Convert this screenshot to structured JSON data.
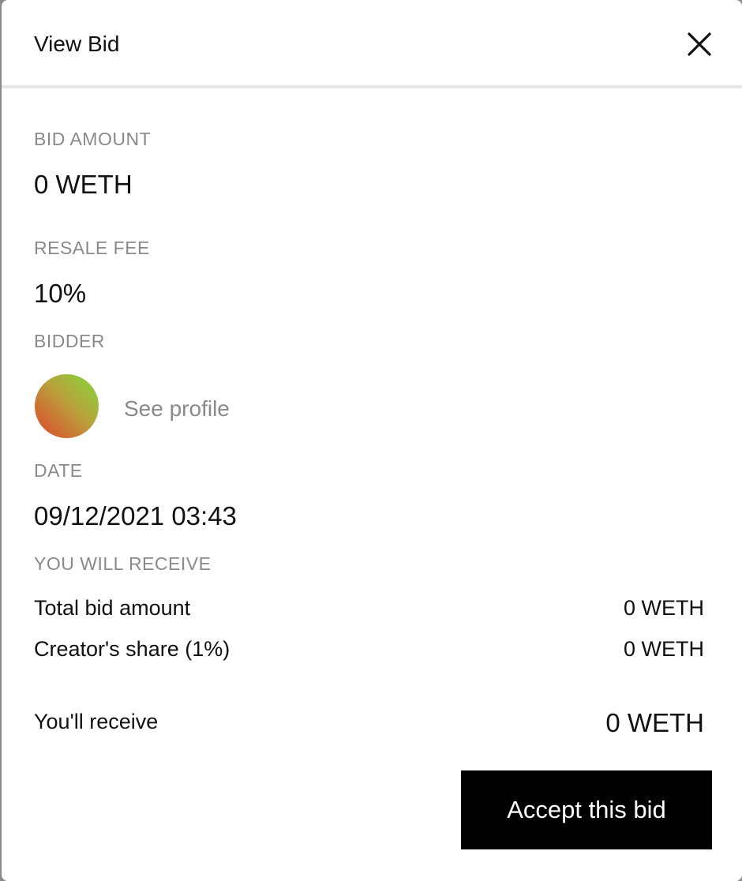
{
  "modal": {
    "title": "View Bid",
    "close_icon": "close-icon"
  },
  "bid_amount": {
    "label": "BID AMOUNT",
    "value": "0 WETH"
  },
  "resale_fee": {
    "label": "RESALE FEE",
    "value": "10%"
  },
  "bidder": {
    "label": "BIDDER",
    "avatar_colors": [
      "#7fdc3a",
      "#e0432c"
    ],
    "profile_link": "See profile"
  },
  "date": {
    "label": "DATE",
    "value": "09/12/2021 03:43"
  },
  "receive": {
    "label": "YOU WILL RECEIVE",
    "rows": [
      {
        "label": "Total bid amount",
        "value": "0 WETH"
      },
      {
        "label": "Creator's share (1%)",
        "value": "0 WETH"
      }
    ],
    "total_label": "You'll receive",
    "total_value": "0 WETH"
  },
  "actions": {
    "accept_label": "Accept this bid",
    "accept_bg": "#000000"
  }
}
